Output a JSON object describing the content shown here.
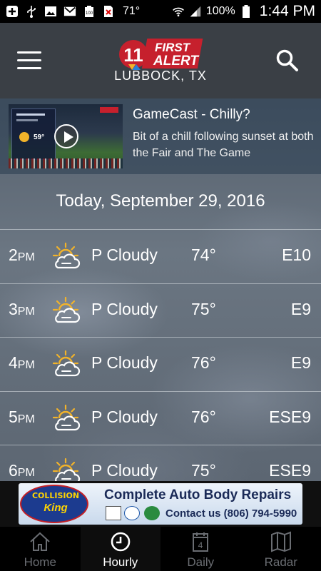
{
  "status_bar": {
    "temperature": "71°",
    "battery": "100%",
    "time": "1:44 PM",
    "icons": [
      "plus-icon",
      "usb-icon",
      "image-icon",
      "gmail-icon",
      "battery-icon",
      "no-sim-icon",
      "wifi-icon",
      "signal-icon"
    ]
  },
  "header": {
    "logo_text_top": "FIRST",
    "logo_text_bottom": "ALERT",
    "logo_number": "11",
    "city": "LUBBOCK, TX"
  },
  "news": {
    "title": "GameCast - Chilly?",
    "body": "Bit of a chill following sunset at both the Fair and The Game",
    "thumb_label": "GAME DAY FORECAST",
    "thumb_temp": "59°"
  },
  "date_heading": "Today, September 29, 2016",
  "hours": [
    {
      "hour": "2",
      "ampm": "PM",
      "condition": "P Cloudy",
      "temp": "74°",
      "wind": "E10"
    },
    {
      "hour": "3",
      "ampm": "PM",
      "condition": "P Cloudy",
      "temp": "75°",
      "wind": "E9"
    },
    {
      "hour": "4",
      "ampm": "PM",
      "condition": "P Cloudy",
      "temp": "76°",
      "wind": "E9"
    },
    {
      "hour": "5",
      "ampm": "PM",
      "condition": "P Cloudy",
      "temp": "76°",
      "wind": "ESE9"
    },
    {
      "hour": "6",
      "ampm": "PM",
      "condition": "P Cloudy",
      "temp": "75°",
      "wind": "ESE9"
    }
  ],
  "ad": {
    "brand_top": "COLLISION",
    "brand_bottom": "King",
    "headline": "Complete Auto Body Repairs",
    "phone": "Contact us (806) 794-5990"
  },
  "nav": {
    "items": [
      {
        "label": "Home",
        "icon": "home-icon"
      },
      {
        "label": "Hourly",
        "icon": "clock-icon"
      },
      {
        "label": "Daily",
        "icon": "calendar-icon",
        "badge": "4"
      },
      {
        "label": "Radar",
        "icon": "map-icon"
      }
    ],
    "active": "Hourly"
  },
  "colors": {
    "header_bg": "#3a3f45",
    "logo_red": "#c6202d",
    "nav_active": "#ffffff",
    "nav_inactive": "#6a6d72"
  }
}
